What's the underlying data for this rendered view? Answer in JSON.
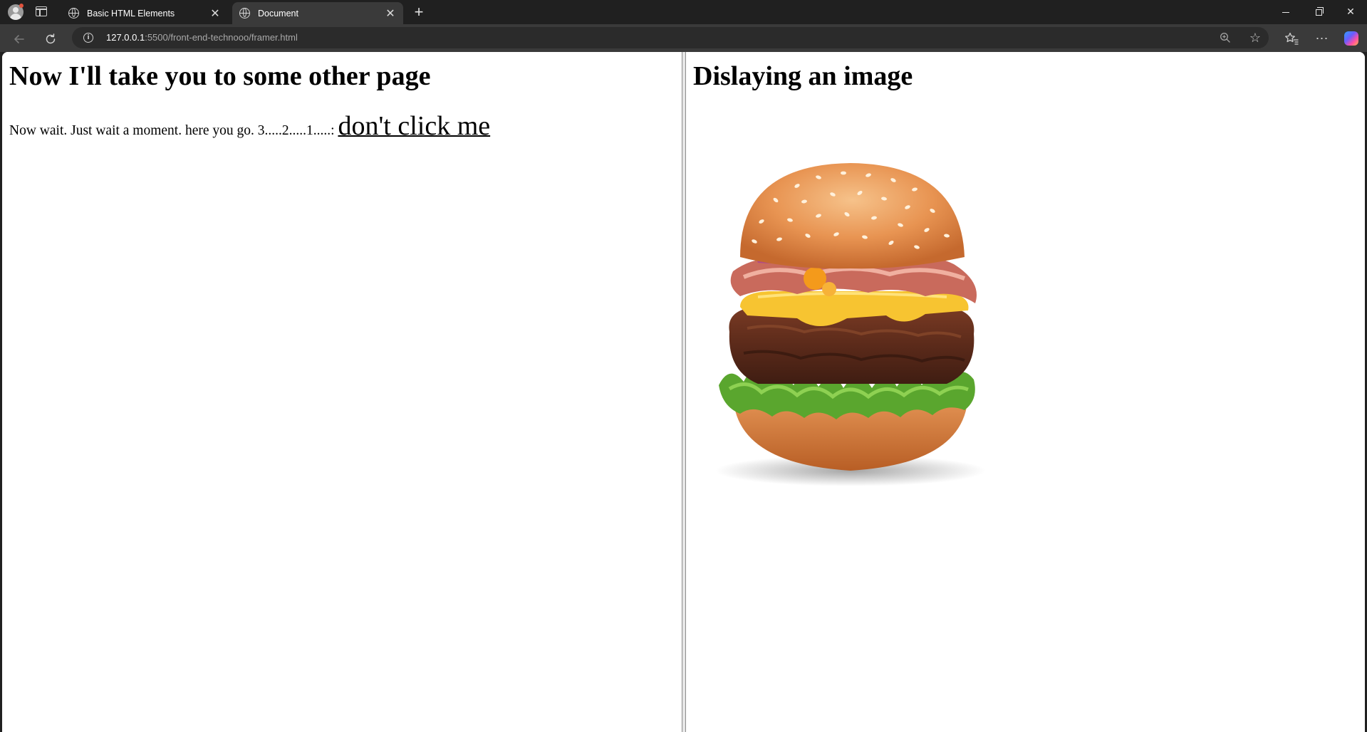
{
  "browser": {
    "tabs": [
      {
        "title": "Basic HTML Elements",
        "active": false
      },
      {
        "title": "Document",
        "active": true
      }
    ],
    "url": {
      "host": "127.0.0.1",
      "rest": ":5500/front-end-technooo/framer.html"
    },
    "icons": {
      "profile": "profile-avatar-icon",
      "tab_actions": "tab-actions-icon",
      "tab_favicon": "globe-icon",
      "new_tab": "plus-icon",
      "back": "arrow-left-icon",
      "reload": "reload-icon",
      "site_info": "info-icon",
      "zoom": "zoom-icon",
      "favorite": "star-icon",
      "favorites": "favorites-icon",
      "more": "more-icon",
      "copilot": "copilot-icon"
    }
  },
  "left_frame": {
    "heading": "Now I'll take you to some other page",
    "text": "Now wait. Just wait a moment. here you go. 3.....2.....1.....: ",
    "link": "don't click me"
  },
  "right_frame": {
    "heading": "Dislaying an image",
    "image": "burger-image"
  },
  "colors": {
    "tabbar_bg": "#202020",
    "toolbar_bg": "#3a3a3a",
    "page_bg": "#ffffff"
  }
}
